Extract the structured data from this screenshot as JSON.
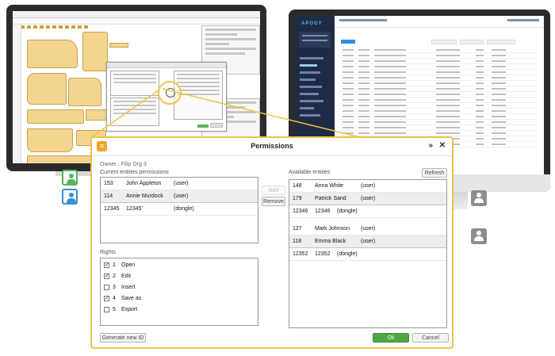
{
  "dialog": {
    "title": "Permissions",
    "collapse_glyph": "»",
    "close_glyph": "✕",
    "logo_glyph": "≡",
    "owner": "Owner : Filip Org 3",
    "current_label": "Current entities permissions",
    "available_label": "Available entities",
    "rights_label": "Rights",
    "buttons": {
      "add": "Add",
      "remove": "Remove",
      "refresh": "Refresh",
      "generate": "Generate new ID",
      "ok": "Ok",
      "cancel": "Cancel"
    },
    "current_entities": [
      {
        "id": "153",
        "name": "John Appleton",
        "type": "(user)",
        "selected": false
      },
      {
        "id": "114",
        "name": "Annie Murdock",
        "type": "(user)",
        "selected": true
      },
      {
        "id": "12345",
        "name": "12345'",
        "type": "(dongle)",
        "selected": false
      }
    ],
    "available_entities": [
      {
        "id": "148",
        "name": "Anna White",
        "type": "(user)",
        "selected": false
      },
      {
        "id": "179",
        "name": "Patrick Sand",
        "type": "(user)",
        "selected": true
      },
      {
        "id": "12346",
        "name": "12346",
        "type": "(dongle)",
        "selected": false
      },
      {
        "id": "127",
        "name": "Mark Johnson",
        "type": "(user)",
        "selected": false
      },
      {
        "id": "118",
        "name": "Emma Black",
        "type": "(user)",
        "selected": true
      },
      {
        "id": "12352",
        "name": "12352",
        "type": "(dongle)",
        "selected": false
      }
    ],
    "rights": [
      {
        "num": "1",
        "name": "Open",
        "checked": true
      },
      {
        "num": "2",
        "name": "Edit",
        "checked": true
      },
      {
        "num": "3",
        "name": "Insert",
        "checked": false
      },
      {
        "num": "4",
        "name": "Save as",
        "checked": true
      },
      {
        "num": "5",
        "name": "Export",
        "checked": false
      }
    ]
  },
  "apogy": {
    "logo": "APOGY"
  },
  "colors": {
    "dialog_border": "#f0c24a",
    "ok_green": "#4ea844",
    "user_green": "#55b255",
    "user_blue": "#3a8fd6",
    "user_grey": "#8d8d8d",
    "apogy_sidebar": "#1f2b45",
    "pattern_piece": "#f3d590"
  }
}
